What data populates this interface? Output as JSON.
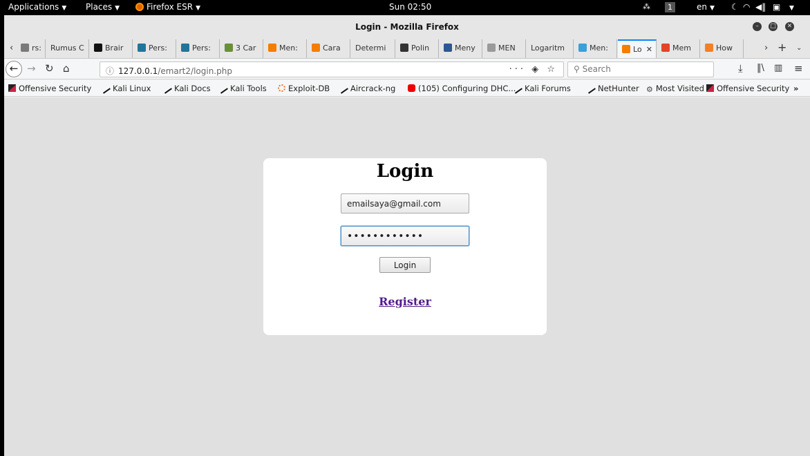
{
  "topbar": {
    "applications": "Applications",
    "places": "Places",
    "app_name": "Firefox ESR",
    "clock": "Sun 02:50",
    "workspace": "1",
    "keyboard": "en"
  },
  "window": {
    "title": "Login - Mozilla Firefox"
  },
  "tabs": [
    {
      "label": "rs:",
      "fav_color": "#7a7a7a"
    },
    {
      "label": "Rumus C",
      "fav_color": ""
    },
    {
      "label": "Brair",
      "fav_color": "#111111"
    },
    {
      "label": "Pers:",
      "fav_color": "#21759b"
    },
    {
      "label": "Pers:",
      "fav_color": "#21759b"
    },
    {
      "label": "3 Car",
      "fav_color": "#6a8f3a"
    },
    {
      "label": "Men:",
      "fav_color": "#f57d00"
    },
    {
      "label": "Cara",
      "fav_color": "#f57d00"
    },
    {
      "label": "Determi",
      "fav_color": ""
    },
    {
      "label": "Polin",
      "fav_color": "#333333"
    },
    {
      "label": "Meny",
      "fav_color": "#2b5797"
    },
    {
      "label": "MEN",
      "fav_color": "#9a9a9a"
    },
    {
      "label": "Logaritm",
      "fav_color": ""
    },
    {
      "label": "Men:",
      "fav_color": "#3aa0d8"
    },
    {
      "label": "Lo",
      "fav_color": "#f57d00",
      "active": true
    },
    {
      "label": "Mem",
      "fav_color": "#e2432a"
    },
    {
      "label": "How",
      "fav_color": "#f48024"
    }
  ],
  "navbar": {
    "url_host": "127.0.0.1",
    "url_path": "/emart2/login.php",
    "search_placeholder": "Search"
  },
  "bookmarks": [
    {
      "label": "Offensive Security",
      "icon": "os"
    },
    {
      "label": "Kali Linux",
      "icon": "dragon"
    },
    {
      "label": "Kali Docs",
      "icon": "dragon"
    },
    {
      "label": "Kali Tools",
      "icon": "dragon"
    },
    {
      "label": "Exploit-DB",
      "icon": "db"
    },
    {
      "label": "Aircrack-ng",
      "icon": "dragon"
    },
    {
      "label": "(105) Configuring DHC...",
      "icon": "yt"
    },
    {
      "label": "Kali Forums",
      "icon": "dragon"
    },
    {
      "label": "NetHunter",
      "icon": "dragon"
    },
    {
      "label": "Most Visited",
      "icon": "gear"
    },
    {
      "label": "Offensive Security",
      "icon": "os"
    }
  ],
  "login": {
    "title": "Login",
    "email_value": "emailsaya@gmail.com",
    "password_value": "password1234",
    "button_label": "Login",
    "register_label": "Register"
  }
}
